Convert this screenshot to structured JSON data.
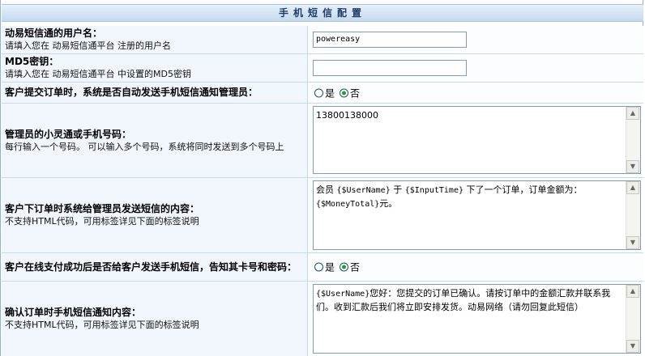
{
  "header": {
    "title": "手机短信配置"
  },
  "rows": {
    "username": {
      "title": "动易短信通的用户名：",
      "desc": "请填入您在 动易短信通平台 注册的用户名",
      "value": "powereasy"
    },
    "md5key": {
      "title": "MD5密钥：",
      "desc": "请填入您在 动易短信通平台 中设置的MD5密钥",
      "value": ""
    },
    "order_notify": {
      "title": "客户提交订单时，系统是否自动发送手机短信通知管理员：",
      "opt_yes": "是",
      "opt_no": "否",
      "selected": "否"
    },
    "admin_phone": {
      "title": "管理员的小灵通或手机号码：",
      "desc": "每行输入一个号码。 可以输入多个号码，系统将同时发送到多个号码上",
      "value": "13800138000"
    },
    "order_msg": {
      "title": "客户下订单时系统给管理员发送短信的内容：",
      "desc": "不支持HTML代码，可用标签详见下面的标签说明",
      "line1_a": "会员 ",
      "tag_user": "{$UserName}",
      "line1_b": " 于 ",
      "tag_time": "{$InputTime}",
      "line1_c": " 下了一个订单，订单金额为：",
      "tag_money": "{$MoneyTotal}",
      "line2_c": "元。"
    },
    "pay_notify": {
      "title": "客户在线支付成功后是否给客户发送手机短信，告知其卡号和密码：",
      "opt_yes": "是",
      "opt_no": "否",
      "selected": "否"
    },
    "confirm_msg": {
      "title": "确认订单时手机短信通知内容：",
      "desc": "不支持HTML代码，可用标签详见下面的标签说明",
      "tag_user": "{$UserName}",
      "text": "您好：您提交的订单已确认。请按订单中的金额汇款并联系我们。收到汇款后我们将立即安排发货。动易网络（请勿回复此短信）"
    }
  },
  "icons": {
    "scroll_up": "scroll-up-arrow",
    "scroll_down": "scroll-down-arrow"
  }
}
